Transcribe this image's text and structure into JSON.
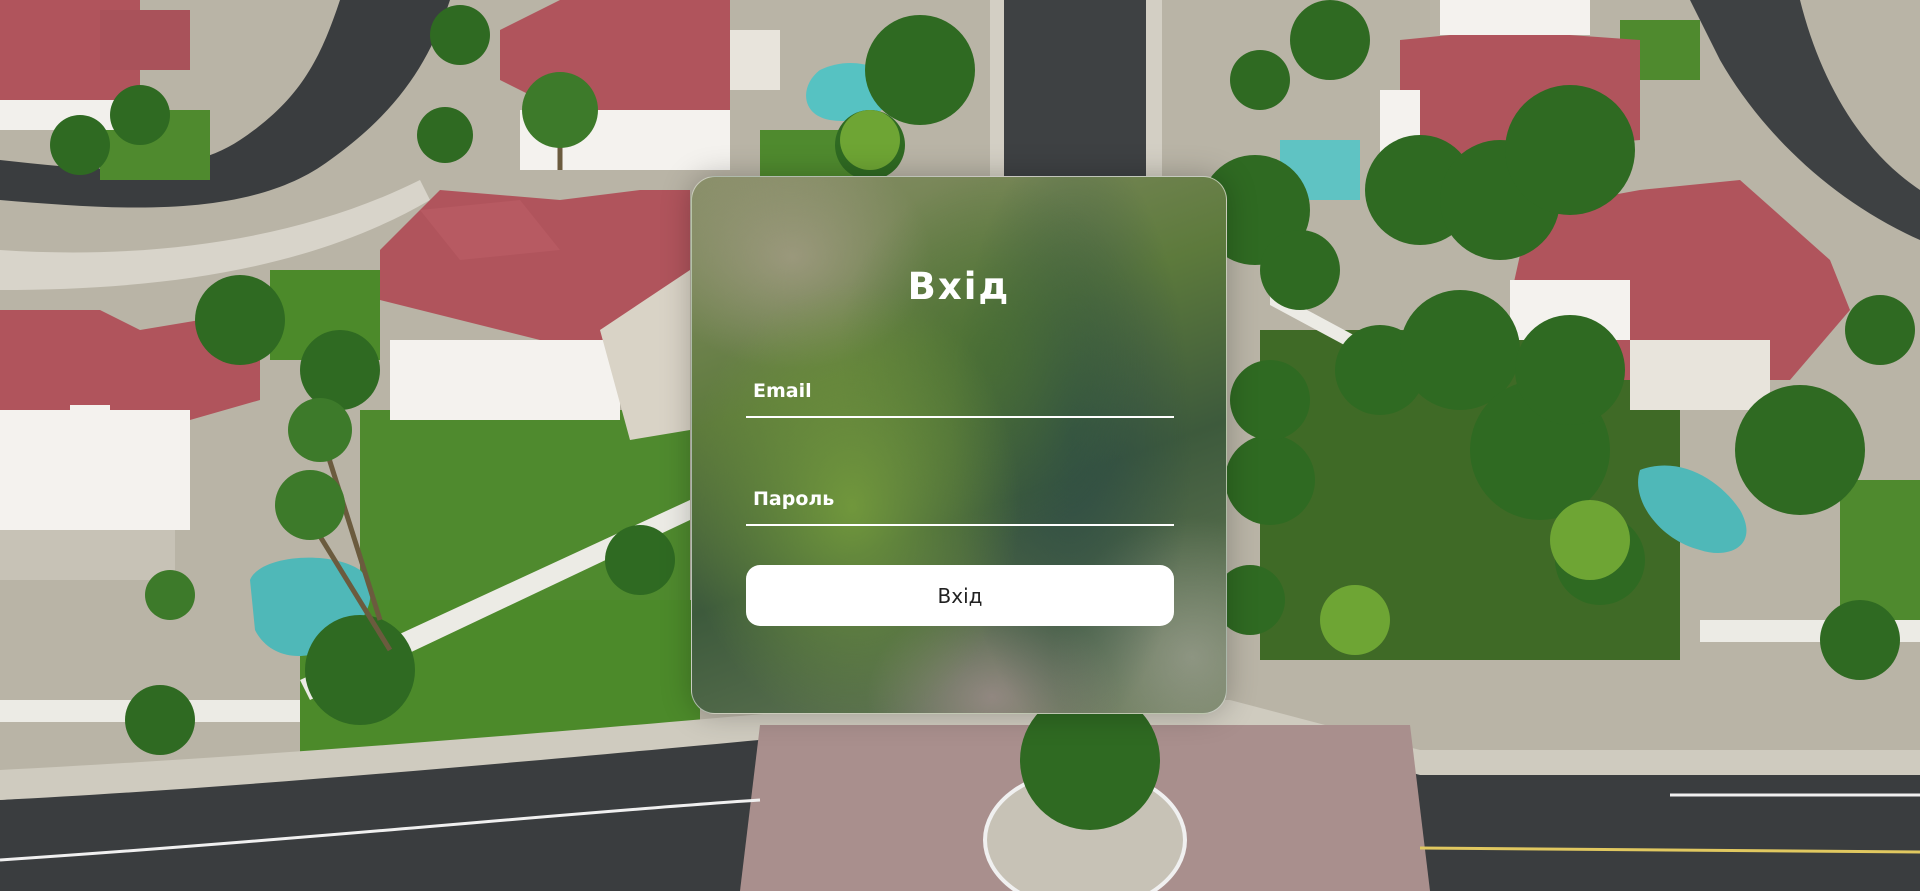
{
  "login": {
    "title": "Вхід",
    "email_label": "Email",
    "password_label": "Пароль",
    "submit_label": "Вхід"
  },
  "colors": {
    "roof": "#b0545c",
    "lawn": "#4f8a2e",
    "road": "#3a3d3f",
    "pool": "#4fb8b8"
  }
}
